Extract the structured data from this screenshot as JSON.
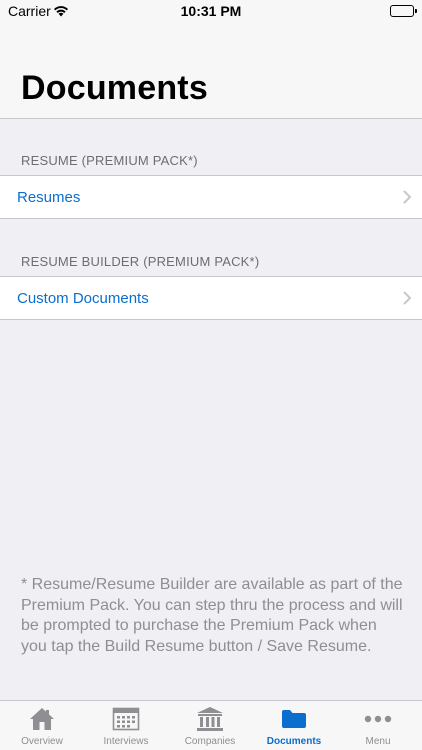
{
  "status_bar": {
    "carrier": "Carrier",
    "time": "10:31 PM"
  },
  "header": {
    "title": "Documents"
  },
  "sections": [
    {
      "header": "RESUME (PREMIUM PACK*)",
      "rows": [
        {
          "label": "Resumes"
        }
      ]
    },
    {
      "header": "RESUME BUILDER (PREMIUM PACK*)",
      "rows": [
        {
          "label": "Custom Documents"
        }
      ]
    }
  ],
  "footnote": "* Resume/Resume Builder are available as part of the Premium Pack.  You can step thru the process and will be prompted to purchase the Premium Pack when you tap the Build Resume button / Save Resume.",
  "tab_bar": {
    "active": "Documents",
    "tabs": [
      {
        "label": "Overview",
        "icon": "home-icon"
      },
      {
        "label": "Interviews",
        "icon": "calendar-icon"
      },
      {
        "label": "Companies",
        "icon": "bank-icon"
      },
      {
        "label": "Documents",
        "icon": "folder-icon"
      },
      {
        "label": "Menu",
        "icon": "more-icon"
      }
    ]
  },
  "colors": {
    "accent": "#0a6ecf",
    "background": "#efeff4",
    "secondary_text": "#6d6d72",
    "inactive_tab": "#8e8e93"
  }
}
